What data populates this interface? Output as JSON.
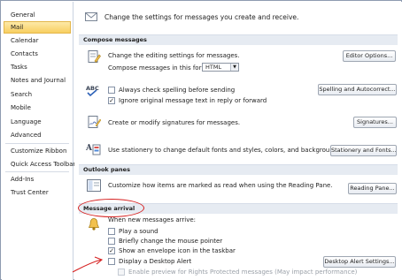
{
  "sidebar": {
    "items": [
      {
        "label": "General"
      },
      {
        "label": "Mail"
      },
      {
        "label": "Calendar"
      },
      {
        "label": "Contacts"
      },
      {
        "label": "Tasks"
      },
      {
        "label": "Notes and Journal"
      },
      {
        "label": "Search"
      },
      {
        "label": "Mobile"
      },
      {
        "label": "Language"
      },
      {
        "label": "Advanced"
      },
      {
        "label": "Customize Ribbon"
      },
      {
        "label": "Quick Access Toolbar"
      },
      {
        "label": "Add-Ins"
      },
      {
        "label": "Trust Center"
      }
    ],
    "selected": "Mail"
  },
  "main": {
    "intro": "Change the settings for messages you create and receive.",
    "compose": {
      "header": "Compose messages",
      "editing_text": "Change the editing settings for messages.",
      "format_label": "Compose messages in this format:",
      "format_value": "HTML",
      "editor_options_button": "Editor Options...",
      "always_check_spelling": "Always check spelling before sending",
      "ignore_original": "Ignore original message text in reply or forward",
      "spelling_button": "Spelling and Autocorrect...",
      "signatures_text": "Create or modify signatures for messages.",
      "signatures_button": "Signatures...",
      "stationery_text": "Use stationery to change default fonts and styles, colors, and backgrounds.",
      "stationery_button": "Stationery and Fonts..."
    },
    "outlook_panes": {
      "header": "Outlook panes",
      "reading_text": "Customize how items are marked as read when using the Reading Pane.",
      "reading_button": "Reading Pane..."
    },
    "message_arrival": {
      "header": "Message arrival",
      "when_new": "When new messages arrive:",
      "play_sound": "Play a sound",
      "change_pointer": "Briefly change the mouse pointer",
      "show_envelope": "Show an envelope icon in the taskbar",
      "desktop_alert": "Display a Desktop Alert",
      "desktop_alert_button": "Desktop Alert Settings...",
      "rights_protected": "Enable preview for Rights Protected messages (May impact performance)"
    }
  },
  "checkboxes": {
    "always_check_spelling": false,
    "ignore_original": true,
    "play_sound": false,
    "change_pointer": false,
    "show_envelope": true,
    "desktop_alert": false,
    "rights_protected": false
  },
  "colors": {
    "selected_nav": "#f8cf60",
    "section_header": "#e6ebf2",
    "annotation": "#d62020"
  }
}
